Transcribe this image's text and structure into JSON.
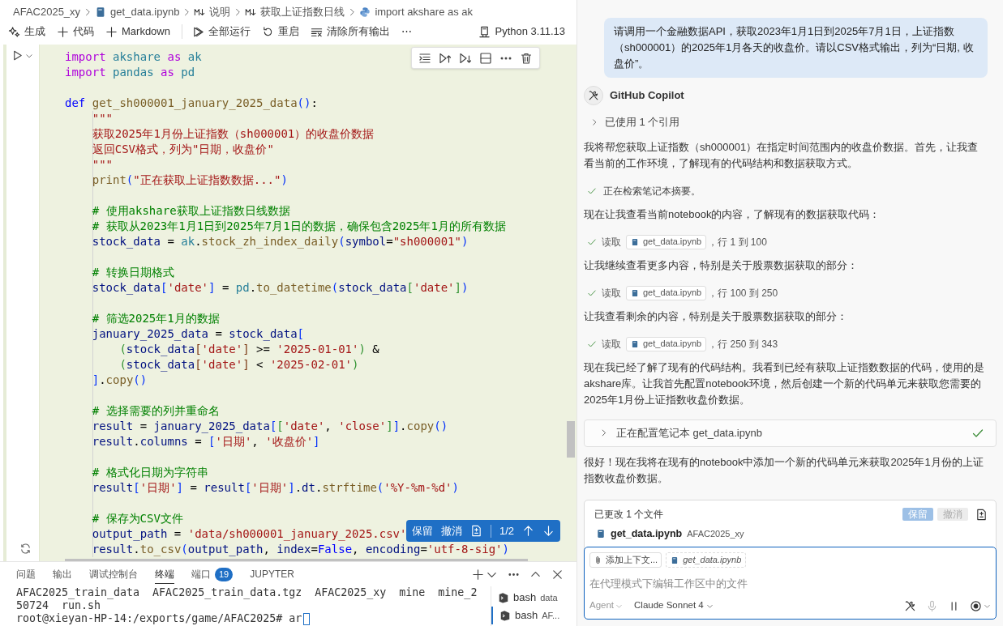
{
  "breadcrumb": [
    {
      "kind": "folder",
      "text": "AFAC2025_xy"
    },
    {
      "kind": "notebook",
      "text": "get_data.ipynb"
    },
    {
      "kind": "markdown",
      "text": "说明"
    },
    {
      "kind": "markdown",
      "text": "获取上证指数日线"
    },
    {
      "kind": "python",
      "text": "import akshare as ak"
    }
  ],
  "toolbar": [
    {
      "kind": "generate",
      "label": "生成"
    },
    {
      "kind": "add",
      "label": "代码"
    },
    {
      "kind": "add",
      "label": "Markdown"
    },
    {
      "kind": "run-all",
      "label": "全部运行"
    },
    {
      "kind": "restart",
      "label": "重启"
    },
    {
      "kind": "clear",
      "label": "清除所有输出"
    },
    {
      "kind": "more",
      "label": "⋯"
    }
  ],
  "kernel": "Python 3.11.13",
  "cell": {
    "blocks": [
      [
        [
          {
            "kind": "keyword",
            "text": "import "
          },
          {
            "kind": "module",
            "text": "akshare "
          },
          {
            "kind": "keyword",
            "text": "as "
          },
          {
            "kind": "module",
            "text": "ak"
          }
        ],
        [
          {
            "kind": "keyword",
            "text": "import "
          },
          {
            "kind": "module",
            "text": "pandas "
          },
          {
            "kind": "keyword",
            "text": "as "
          },
          {
            "kind": "module",
            "text": "pd"
          }
        ]
      ],
      [
        [
          {
            "kind": "def",
            "text": "def "
          },
          {
            "kind": "function",
            "text": "get_sh000001_january_2025_data"
          },
          {
            "kind": "bracket",
            "text": "()"
          },
          {
            "kind": "plain",
            "text": ":"
          }
        ],
        [
          {
            "kind": "string",
            "text": "    \"\"\""
          }
        ],
        [
          {
            "kind": "string",
            "text": "    获取2025年1月份上证指数（sh000001）的收盘价数据"
          }
        ],
        [
          {
            "kind": "string",
            "text": "    返回CSV格式，列为\"日期，收盘价\""
          }
        ],
        [
          {
            "kind": "string",
            "text": "    \"\"\""
          }
        ],
        [
          {
            "kind": "function",
            "text": "    print"
          },
          {
            "kind": "bracket",
            "text": "("
          },
          {
            "kind": "string",
            "text": "\"正在获取上证指数数据...\""
          },
          {
            "kind": "bracket",
            "text": ")"
          }
        ]
      ],
      [
        [
          {
            "kind": "comment",
            "text": "    # 使用akshare获取上证指数日线数据"
          }
        ],
        [
          {
            "kind": "comment",
            "text": "    # 获取从2023年1月1日到2025年7月1日的数据，确保包含2025年1月的所有数据"
          }
        ],
        [
          {
            "kind": "variable",
            "text": "    stock_data"
          },
          {
            "kind": "plain",
            "text": " = "
          },
          {
            "kind": "module",
            "text": "ak"
          },
          {
            "kind": "plain",
            "text": "."
          },
          {
            "kind": "function",
            "text": "stock_zh_index_daily"
          },
          {
            "kind": "bracket",
            "text": "("
          },
          {
            "kind": "variable",
            "text": "symbol"
          },
          {
            "kind": "plain",
            "text": "="
          },
          {
            "kind": "string",
            "text": "\"sh000001\""
          },
          {
            "kind": "bracket",
            "text": ")"
          }
        ]
      ],
      [
        [
          {
            "kind": "comment",
            "text": "    # 转换日期格式"
          }
        ],
        [
          {
            "kind": "variable",
            "text": "    stock_data"
          },
          {
            "kind": "bracket",
            "text": "["
          },
          {
            "kind": "string",
            "text": "'date'"
          },
          {
            "kind": "bracket",
            "text": "]"
          },
          {
            "kind": "plain",
            "text": " = "
          },
          {
            "kind": "module",
            "text": "pd"
          },
          {
            "kind": "plain",
            "text": "."
          },
          {
            "kind": "function",
            "text": "to_datetime"
          },
          {
            "kind": "bracket",
            "text": "("
          },
          {
            "kind": "variable",
            "text": "stock_data"
          },
          {
            "kind": "bracket2",
            "text": "["
          },
          {
            "kind": "string",
            "text": "'date'"
          },
          {
            "kind": "bracket2",
            "text": "]"
          },
          {
            "kind": "bracket",
            "text": ")"
          }
        ]
      ],
      [
        [
          {
            "kind": "comment",
            "text": "    # 筛选2025年1月的数据"
          }
        ],
        [
          {
            "kind": "variable",
            "text": "    january_2025_data"
          },
          {
            "kind": "plain",
            "text": " = "
          },
          {
            "kind": "variable",
            "text": "stock_data"
          },
          {
            "kind": "bracket",
            "text": "["
          }
        ],
        [
          {
            "kind": "bracket2",
            "text": "        ("
          },
          {
            "kind": "variable",
            "text": "stock_data"
          },
          {
            "kind": "bracket3",
            "text": "["
          },
          {
            "kind": "string",
            "text": "'date'"
          },
          {
            "kind": "bracket3",
            "text": "]"
          },
          {
            "kind": "plain",
            "text": " >= "
          },
          {
            "kind": "string",
            "text": "'2025-01-01'"
          },
          {
            "kind": "bracket2",
            "text": ")"
          },
          {
            "kind": "plain",
            "text": " &"
          }
        ],
        [
          {
            "kind": "bracket2",
            "text": "        ("
          },
          {
            "kind": "variable",
            "text": "stock_data"
          },
          {
            "kind": "bracket3",
            "text": "["
          },
          {
            "kind": "string",
            "text": "'date'"
          },
          {
            "kind": "bracket3",
            "text": "]"
          },
          {
            "kind": "plain",
            "text": " < "
          },
          {
            "kind": "string",
            "text": "'2025-02-01'"
          },
          {
            "kind": "bracket2",
            "text": ")"
          }
        ],
        [
          {
            "kind": "bracket",
            "text": "    ]"
          },
          {
            "kind": "plain",
            "text": "."
          },
          {
            "kind": "function",
            "text": "copy"
          },
          {
            "kind": "bracket",
            "text": "()"
          }
        ]
      ],
      [
        [
          {
            "kind": "comment",
            "text": "    # 选择需要的列并重命名"
          }
        ],
        [
          {
            "kind": "variable",
            "text": "    result"
          },
          {
            "kind": "plain",
            "text": " = "
          },
          {
            "kind": "variable",
            "text": "january_2025_data"
          },
          {
            "kind": "bracket",
            "text": "["
          },
          {
            "kind": "bracket2",
            "text": "["
          },
          {
            "kind": "string",
            "text": "'date'"
          },
          {
            "kind": "plain",
            "text": ", "
          },
          {
            "kind": "string",
            "text": "'close'"
          },
          {
            "kind": "bracket2",
            "text": "]"
          },
          {
            "kind": "bracket",
            "text": "]"
          },
          {
            "kind": "plain",
            "text": "."
          },
          {
            "kind": "function",
            "text": "copy"
          },
          {
            "kind": "bracket",
            "text": "()"
          }
        ],
        [
          {
            "kind": "variable",
            "text": "    result"
          },
          {
            "kind": "plain",
            "text": "."
          },
          {
            "kind": "variable",
            "text": "columns"
          },
          {
            "kind": "plain",
            "text": " = "
          },
          {
            "kind": "bracket",
            "text": "["
          },
          {
            "kind": "string",
            "text": "'日期'"
          },
          {
            "kind": "plain",
            "text": ", "
          },
          {
            "kind": "string",
            "text": "'收盘价'"
          },
          {
            "kind": "bracket",
            "text": "]"
          }
        ]
      ],
      [
        [
          {
            "kind": "comment",
            "text": "    # 格式化日期为字符串"
          }
        ],
        [
          {
            "kind": "variable",
            "text": "    result"
          },
          {
            "kind": "bracket",
            "text": "["
          },
          {
            "kind": "string",
            "text": "'日期'"
          },
          {
            "kind": "bracket",
            "text": "]"
          },
          {
            "kind": "plain",
            "text": " = "
          },
          {
            "kind": "variable",
            "text": "result"
          },
          {
            "kind": "bracket",
            "text": "["
          },
          {
            "kind": "string",
            "text": "'日期'"
          },
          {
            "kind": "bracket",
            "text": "]"
          },
          {
            "kind": "plain",
            "text": "."
          },
          {
            "kind": "variable",
            "text": "dt"
          },
          {
            "kind": "plain",
            "text": "."
          },
          {
            "kind": "function",
            "text": "strftime"
          },
          {
            "kind": "bracket",
            "text": "("
          },
          {
            "kind": "string",
            "text": "'%Y-%m-%d'"
          },
          {
            "kind": "bracket",
            "text": ")"
          }
        ]
      ],
      [
        [
          {
            "kind": "comment",
            "text": "    # 保存为CSV文件"
          }
        ],
        [
          {
            "kind": "variable",
            "text": "    output_path"
          },
          {
            "kind": "plain",
            "text": " = "
          },
          {
            "kind": "string",
            "text": "'data/sh000001_january_2025.csv'"
          }
        ],
        [
          {
            "kind": "variable",
            "text": "    result"
          },
          {
            "kind": "plain",
            "text": "."
          },
          {
            "kind": "function",
            "text": "to_csv"
          },
          {
            "kind": "bracket",
            "text": "("
          },
          {
            "kind": "variable",
            "text": "output_path"
          },
          {
            "kind": "plain",
            "text": ", "
          },
          {
            "kind": "variable",
            "text": "index"
          },
          {
            "kind": "plain",
            "text": "="
          },
          {
            "kind": "def",
            "text": "False"
          },
          {
            "kind": "plain",
            "text": ", "
          },
          {
            "kind": "variable",
            "text": "encoding"
          },
          {
            "kind": "plain",
            "text": "="
          },
          {
            "kind": "string",
            "text": "'utf-8-sig'"
          },
          {
            "kind": "bracket",
            "text": ")"
          }
        ]
      ]
    ]
  },
  "diff_widget": {
    "keep": "保留",
    "undo": "撤消",
    "counter": "1/2"
  },
  "panel": {
    "tabs": [
      {
        "label": "问题",
        "selected": false
      },
      {
        "label": "输出",
        "selected": false
      },
      {
        "label": "调试控制台",
        "selected": false
      },
      {
        "label": "终端",
        "selected": true
      },
      {
        "label": "端口",
        "selected": false,
        "badge": "19"
      },
      {
        "label": "JUPYTER",
        "selected": false
      }
    ],
    "terminal_lines": [
      "AFAC2025_train_data  AFAC2025_train_data.tgz  AFAC2025_xy  mine  mine_2",
      "50724  run.sh",
      "root@xieyan-HP-14:/exports/game/AFAC2025# ar"
    ],
    "sessions": [
      {
        "name": "bash",
        "detail": "data",
        "selected": false
      },
      {
        "name": "bash",
        "detail": "AF...",
        "selected": true
      }
    ]
  },
  "chat": {
    "user_message": "请调用一个金融数据API，获取2023年1月1日到2025年7月1日，上证指数（sh000001）的2025年1月各天的收盘价。请以CSV格式输出，列为“日期, 收盘价”。",
    "assistant": "GitHub Copilot",
    "references": "已使用 1 个引用",
    "items": [
      {
        "kind": "text",
        "text": "我将帮您获取上证指数（sh000001）在指定时间范围内的收盘价数据。首先，让我查看当前的工作环境，了解现有的代码结构和数据获取方式。"
      },
      {
        "kind": "step",
        "text": "正在检索笔记本摘要。"
      },
      {
        "kind": "text",
        "text": "现在让我查看当前notebook的内容，了解现有的数据获取代码："
      },
      {
        "kind": "read",
        "verb": "读取",
        "file": "get_data.ipynb",
        "range": "，行 1 到 100"
      },
      {
        "kind": "text",
        "text": "让我继续查看更多内容，特别是关于股票数据获取的部分："
      },
      {
        "kind": "read",
        "verb": "读取",
        "file": "get_data.ipynb",
        "range": "，行 100 到 250"
      },
      {
        "kind": "text",
        "text": "让我查看剩余的内容，特别是关于股票数据获取的部分："
      },
      {
        "kind": "read",
        "verb": "读取",
        "file": "get_data.ipynb",
        "range": "，行 250 到 343"
      },
      {
        "kind": "text",
        "text": "现在我已经了解了现有的代码结构。我看到已经有获取上证指数数据的代码，使用的是akshare库。让我首先配置notebook环境，然后创建一个新的代码单元来获取您需要的2025年1月份上证指数收盘价数据。"
      },
      {
        "kind": "task",
        "text": "正在配置笔记本 get_data.ipynb"
      },
      {
        "kind": "text",
        "text": "很好！现在我将在现有的notebook中添加一个新的代码单元来获取2025年1月份的上证指数收盘价数据。"
      }
    ]
  },
  "changes": {
    "title": "已更改 1 个文件",
    "keep": "保留",
    "undo": "撤消",
    "disabled": true,
    "file": "get_data.ipynb",
    "folder": "AFAC2025_xy"
  },
  "input": {
    "context_button": "添加上下文...",
    "attachment": "get_data.ipynb",
    "placeholder": "在代理模式下编辑工作区中的文件",
    "mode": "Agent",
    "model": "Claude Sonnet 4"
  }
}
